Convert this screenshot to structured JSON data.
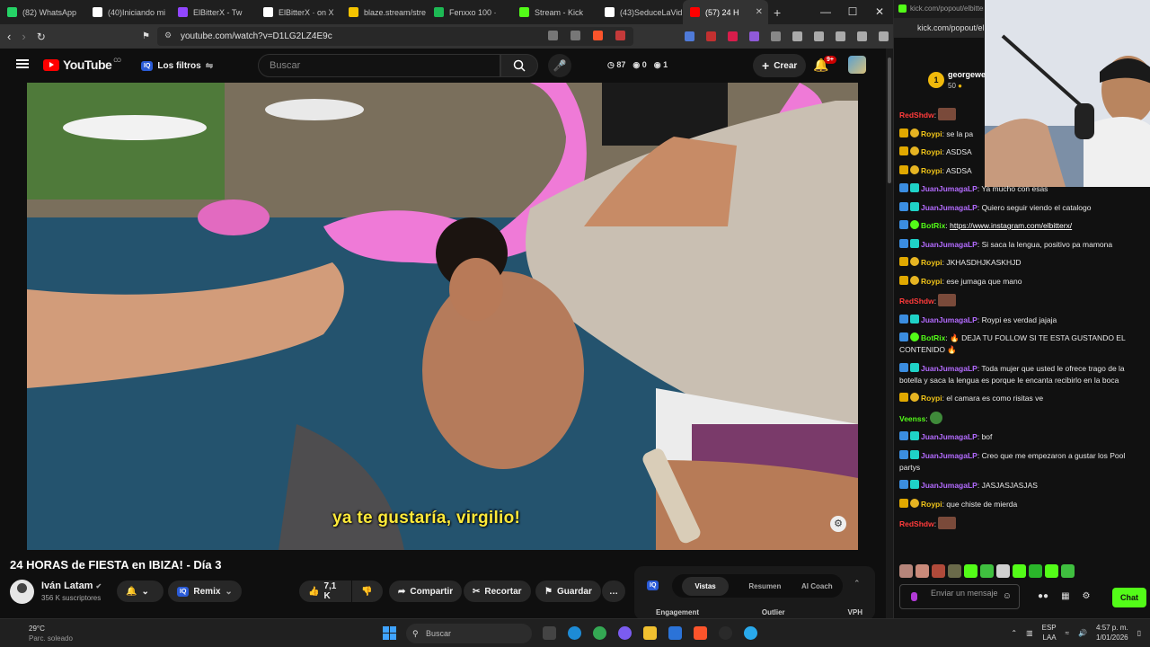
{
  "browser": {
    "tabs": [
      {
        "label": "(82) WhatsApp",
        "color": "#25d366"
      },
      {
        "label": "(40)Iniciando mi",
        "color": "#ffffff"
      },
      {
        "label": "ElBitterX - Tw",
        "color": "#9146ff"
      },
      {
        "label": "ElBitterX · on X",
        "color": "#ffffff"
      },
      {
        "label": "blaze.stream/stre",
        "color": "#f5c400"
      },
      {
        "label": "Fenxxo 100 ·",
        "color": "#1db954"
      },
      {
        "label": "Stream - Kick",
        "color": "#53fc18"
      },
      {
        "label": "(43)SeduceLaVid",
        "color": "#ffffff"
      },
      {
        "label": "(57) 24 H",
        "color": "#ff0000",
        "active": true
      }
    ],
    "url": "youtube.com/watch?v=D1LG2LZ4E9c",
    "new_tab": "+",
    "minimize": "—",
    "maximize": "☐",
    "close": "✕",
    "tab_close": "✕"
  },
  "youtube": {
    "logo_text": "YouTube",
    "logo_sup": "CO",
    "filters_badge": "IQ",
    "filters_label": "Los filtros",
    "search_placeholder": "Buscar",
    "stats": {
      "views": "87",
      "a": "0",
      "b": "1"
    },
    "create_label": "Crear",
    "notif_count": "9+",
    "video": {
      "subtitle": "ya te gustaría, virgilio!",
      "title": "24 HORAS de FIESTA en IBIZA! - Día 3"
    },
    "channel": {
      "name": "Iván Latam",
      "subscribers": "356 K suscriptores"
    },
    "actions": {
      "remix": "Remix",
      "likes": "7,1 K",
      "share": "Compartir",
      "clip": "Recortar",
      "save": "Guardar",
      "more": "…"
    },
    "iq_panel": {
      "tabs": [
        "Vistas",
        "Resumen",
        "AI Coach"
      ],
      "columns": [
        "Engagement",
        "Outlier",
        "VPH"
      ]
    }
  },
  "kick": {
    "url_top": "kick.com/popout/elbitterx",
    "url": "kick.com/popout/elbittx",
    "top_gifter": {
      "name": "georgewe",
      "rank": "1",
      "amount": "50"
    },
    "messages": [
      {
        "user": "RedShdw",
        "color": "#ff3b3b",
        "badges": [],
        "text": "",
        "emote": true
      },
      {
        "user": "Roypi",
        "color": "#f0c419",
        "badges": [
          "crown",
          "gold"
        ],
        "text": "se la pa"
      },
      {
        "user": "Roypi",
        "color": "#f0c419",
        "badges": [
          "crown",
          "gold"
        ],
        "text": "ASDSA"
      },
      {
        "user": "Roypi",
        "color": "#f0c419",
        "badges": [
          "crown",
          "gold"
        ],
        "text": "ASDSA"
      },
      {
        "user": "JuanJumagaLP",
        "color": "#b36bff",
        "badges": [
          "blue",
          "teal"
        ],
        "text": "Ya mucho con esas"
      },
      {
        "user": "JuanJumagaLP",
        "color": "#b36bff",
        "badges": [
          "blue",
          "teal"
        ],
        "text": "Quiero seguir viendo el catalogo"
      },
      {
        "user": "BotRix",
        "color": "#53fc18",
        "badges": [
          "blue",
          "green"
        ],
        "text": "",
        "link": "https://www.instagram.com/elbitterx/"
      },
      {
        "user": "JuanJumagaLP",
        "color": "#b36bff",
        "badges": [
          "blue",
          "teal"
        ],
        "text": "Si saca la lengua, positivo pa mamona"
      },
      {
        "user": "Roypi",
        "color": "#f0c419",
        "badges": [
          "crown",
          "gold"
        ],
        "text": "JKHASDHJKASKHJD"
      },
      {
        "user": "Roypi",
        "color": "#f0c419",
        "badges": [
          "crown",
          "gold"
        ],
        "text": "ese jumaga que mano"
      },
      {
        "user": "RedShdw",
        "color": "#ff3b3b",
        "badges": [],
        "text": "",
        "emote": true
      },
      {
        "user": "JuanJumagaLP",
        "color": "#b36bff",
        "badges": [
          "blue",
          "teal"
        ],
        "text": "Roypi es verdad jajaja"
      },
      {
        "user": "BotRix",
        "color": "#53fc18",
        "badges": [
          "blue",
          "green"
        ],
        "text": "🔥 DEJA TU FOLLOW SI TE ESTA GUSTANDO EL CONTENIDO 🔥"
      },
      {
        "user": "JuanJumagaLP",
        "color": "#b36bff",
        "badges": [
          "blue",
          "teal"
        ],
        "text": "Toda mujer que usted le ofrece trago de la botella y saca la lengua es porque le encanta recibirlo en la boca"
      },
      {
        "user": "Roypi",
        "color": "#f0c419",
        "badges": [
          "crown",
          "gold"
        ],
        "text": "el camara es como risitas ve"
      },
      {
        "user": "Veenss",
        "color": "#53fc18",
        "badges": [],
        "text": "",
        "emote": true
      },
      {
        "user": "JuanJumagaLP",
        "color": "#b36bff",
        "badges": [
          "blue",
          "teal"
        ],
        "text": "bof"
      },
      {
        "user": "JuanJumagaLP",
        "color": "#b36bff",
        "badges": [
          "blue",
          "teal"
        ],
        "text": "Creo que me empezaron a gustar los Pool partys"
      },
      {
        "user": "JuanJumagaLP",
        "color": "#b36bff",
        "badges": [
          "blue",
          "teal"
        ],
        "text": "JASJASJASJAS"
      },
      {
        "user": "Roypi",
        "color": "#f0c419",
        "badges": [
          "crown",
          "gold"
        ],
        "text": "que chiste de mierda"
      },
      {
        "user": "RedShdw",
        "color": "#ff3b3b",
        "badges": [],
        "text": "",
        "emote": true
      }
    ],
    "send_placeholder": "Enviar un mensaje",
    "chat_button": "Chat"
  },
  "taskbar": {
    "weather_temp": "29°C",
    "weather_desc": "Parc. soleado",
    "search": "Buscar",
    "lang": "ESP",
    "lang2": "LAA",
    "time": "4:57 p. m.",
    "date": "1/01/2026"
  }
}
